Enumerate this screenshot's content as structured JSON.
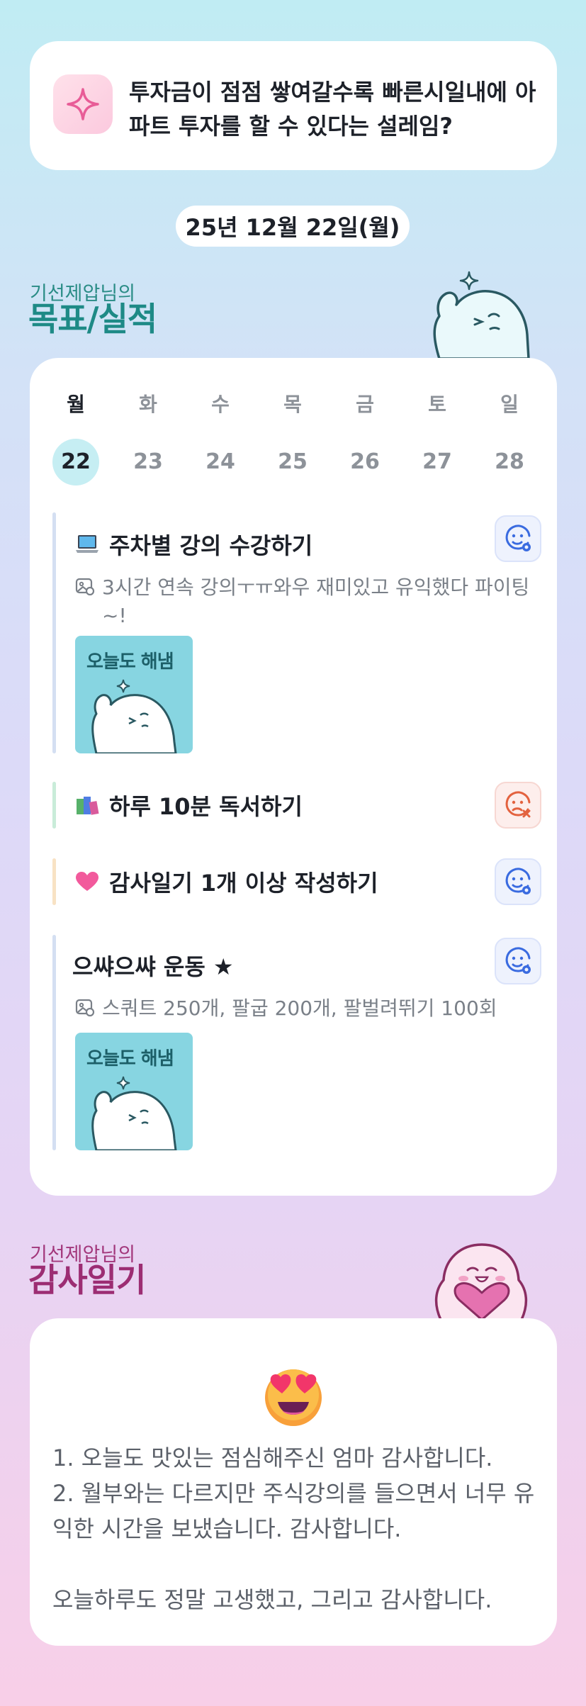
{
  "header": {
    "message": "투자금이 점점 쌓여갈수록 빠른시일내에 아파트 투자를 할 수 있다는 설레임?",
    "icon": "sparkle-icon"
  },
  "date": "25년 12월 22일(월)",
  "goals_section": {
    "owner": "기선제압님의",
    "title": "목표/실적"
  },
  "week": [
    {
      "day": "월",
      "date": "22",
      "active": true
    },
    {
      "day": "화",
      "date": "23",
      "active": false
    },
    {
      "day": "수",
      "date": "24",
      "active": false
    },
    {
      "day": "목",
      "date": "25",
      "active": false
    },
    {
      "day": "금",
      "date": "26",
      "active": false
    },
    {
      "day": "토",
      "date": "27",
      "active": false
    },
    {
      "day": "일",
      "date": "28",
      "active": false
    }
  ],
  "goals": [
    {
      "title": "주차별 강의 수강하기",
      "emoji": "laptop-emoji",
      "bar_color": "#d4dff2",
      "status": "good",
      "note": "3시간 연속 강의ㅜㅠ와우 재미있고 유익했다 파이팅~!",
      "photo_text": "오늘도 해냄"
    },
    {
      "title": "하루 10분 독서하기",
      "emoji": "books-emoji",
      "bar_color": "#c9ecd9",
      "status": "bad"
    },
    {
      "title": "감사일기 1개 이상 작성하기",
      "emoji": "heart-emoji",
      "bar_color": "#f8e2c4",
      "status": "good"
    },
    {
      "title": "으쌰으쌰 운동 ★",
      "bar_color": "#d4dff2",
      "status": "good",
      "note": "스쿼트 250개, 팔굽 200개, 팔벌려뛰기 100회",
      "photo_text": "오늘도 해냄"
    }
  ],
  "gratitude_section": {
    "owner": "기선제압님의",
    "title": "감사일기",
    "emoji": "heart-eyes-emoji",
    "text": "1. 오늘도 맛있는 점심해주신 엄마 감사합니다.\n2. 월부와는 다르지만 주식강의를 들으면서 너무 유익한 시간을 보냈습니다. 감사합니다.\n\n오늘하루도 정말 고생했고, 그리고 감사합니다."
  },
  "colors": {
    "goal_title": "#1e8a86",
    "gratitude_title": "#9c2d73",
    "active_day": "#c6eef3",
    "good_face": "#3a6be0",
    "bad_face": "#e3623f"
  }
}
